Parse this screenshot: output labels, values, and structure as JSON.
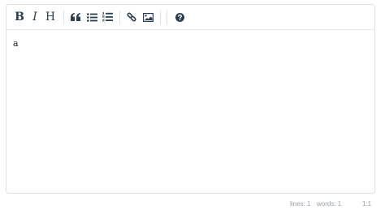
{
  "toolbar": {
    "bold_label": "B",
    "italic_label": "I",
    "heading_label": "H",
    "buttons": [
      "bold",
      "italic",
      "heading",
      "quote",
      "unordered-list",
      "ordered-list",
      "link",
      "image",
      "help"
    ]
  },
  "editor": {
    "content": "a"
  },
  "statusbar": {
    "lines_label": "lines: 1",
    "words_label": "words: 1",
    "cursor_label": "1:1"
  },
  "colors": {
    "icon": "#2c3e50",
    "border": "#dde1e5",
    "status_text": "#9aa0a6"
  }
}
